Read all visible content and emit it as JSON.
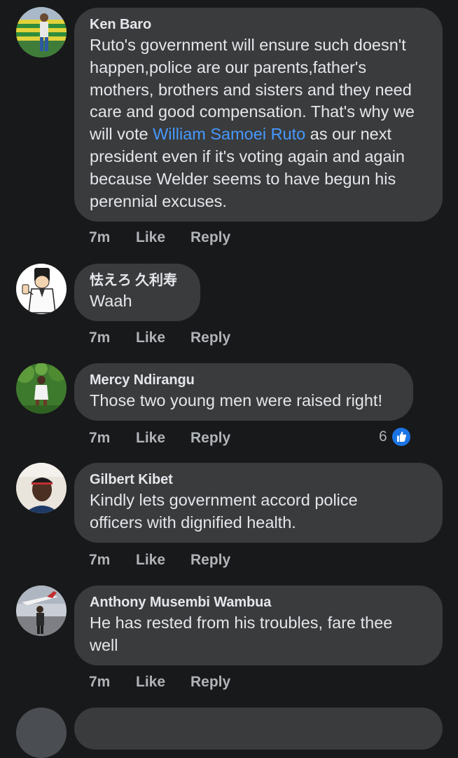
{
  "comments": [
    {
      "author": "Ken Baro",
      "text_before": "Ruto's government will ensure such doesn't happen,police are our parents,father's mothers, brothers and sisters and they need care and good compensation. That's why we will vote ",
      "mention": "William Samoei Ruto",
      "text_after": " as our next president even if it's voting again and again because Welder seems to have begun his perennial excuses.",
      "time": "7m",
      "like": "Like",
      "reply": "Reply"
    },
    {
      "author": "怯えろ 久利寿",
      "text": "Waah",
      "time": "7m",
      "like": "Like",
      "reply": "Reply"
    },
    {
      "author": "Mercy Ndirangu",
      "text": "Those two young men were raised right!",
      "time": "7m",
      "like": "Like",
      "reply": "Reply",
      "reaction_count": "6"
    },
    {
      "author": "Gilbert Kibet",
      "text": "Kindly lets government accord police officers with dignified health.",
      "time": "7m",
      "like": "Like",
      "reply": "Reply"
    },
    {
      "author": "Anthony Musembi Wambua",
      "text": "He has rested from his troubles, fare thee well",
      "time": "7m",
      "like": "Like",
      "reply": "Reply"
    }
  ],
  "icons": {
    "reaction": "like-thumb-icon"
  },
  "colors": {
    "background": "#18191a",
    "bubble": "#3a3b3c",
    "text": "#e4e6eb",
    "secondary_text": "#b0b3b8",
    "mention": "#4599ff",
    "like_reaction": "#1b74e4"
  }
}
